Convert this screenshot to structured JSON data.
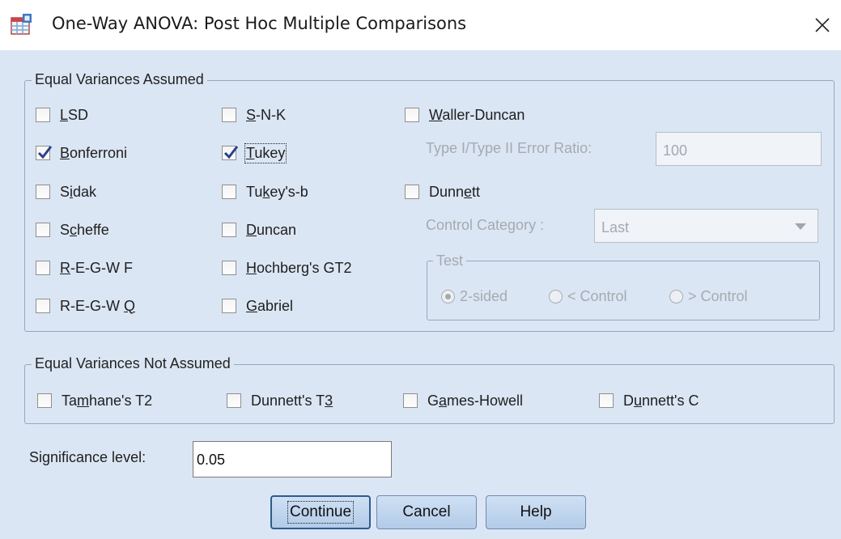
{
  "window": {
    "title": "One-Way ANOVA: Post Hoc Multiple Comparisons",
    "close_glyph": "✕"
  },
  "equal_assumed": {
    "legend": "Equal Variances Assumed",
    "col1": [
      {
        "pre": "",
        "u": "L",
        "post": "SD",
        "checked": false
      },
      {
        "pre": "",
        "u": "B",
        "post": "onferroni",
        "checked": true
      },
      {
        "pre": "S",
        "u": "i",
        "post": "dak",
        "checked": false
      },
      {
        "pre": "S",
        "u": "c",
        "post": "heffe",
        "checked": false
      },
      {
        "pre": "",
        "u": "R",
        "post": "-E-G-W F",
        "checked": false
      },
      {
        "pre": "R-E-G-W ",
        "u": "Q",
        "post": "",
        "checked": false
      }
    ],
    "col2": [
      {
        "pre": "",
        "u": "S",
        "post": "-N-K",
        "checked": false
      },
      {
        "pre": "",
        "u": "T",
        "post": "ukey",
        "checked": true
      },
      {
        "pre": "Tu",
        "u": "k",
        "post": "ey's-b",
        "checked": false
      },
      {
        "pre": "",
        "u": "D",
        "post": "uncan",
        "checked": false
      },
      {
        "pre": "",
        "u": "H",
        "post": "ochberg's GT2",
        "checked": false
      },
      {
        "pre": "",
        "u": "G",
        "post": "abriel",
        "checked": false
      }
    ],
    "waller": {
      "pre": "",
      "u": "W",
      "post": "aller-Duncan",
      "checked": false
    },
    "ratio_label": "Type I/Type II Error Ratio:",
    "ratio_value": "100",
    "dunnett": {
      "pre": "Dunn",
      "u": "e",
      "post": "tt",
      "checked": false
    },
    "control_label": "Control Category :",
    "control_value": "Last",
    "test_legend": "Test",
    "test_options": [
      "2-sided",
      "< Control",
      "> Control"
    ],
    "test_selected": 0
  },
  "equal_not_assumed": {
    "legend": "Equal Variances Not Assumed",
    "items": [
      {
        "pre": "Ta",
        "u": "m",
        "post": "hane's T2",
        "checked": false
      },
      {
        "pre": "Dunnett's T",
        "u": "3",
        "post": "",
        "checked": false
      },
      {
        "pre": "G",
        "u": "a",
        "post": "mes-Howell",
        "checked": false
      },
      {
        "pre": "D",
        "u": "u",
        "post": "nnett's C",
        "checked": false
      }
    ]
  },
  "significance": {
    "label": "Significance level:",
    "value": "0.05"
  },
  "buttons": {
    "continue": "Continue",
    "cancel": "Cancel",
    "help": "Help"
  },
  "colors": {
    "client_bg": "#dbe6f4",
    "check": "#2b3f8c",
    "button": "#b9d1ec"
  },
  "icons": {
    "app": "spss-table-icon",
    "close": "close-icon",
    "dropdown": "chevron-down-icon"
  }
}
